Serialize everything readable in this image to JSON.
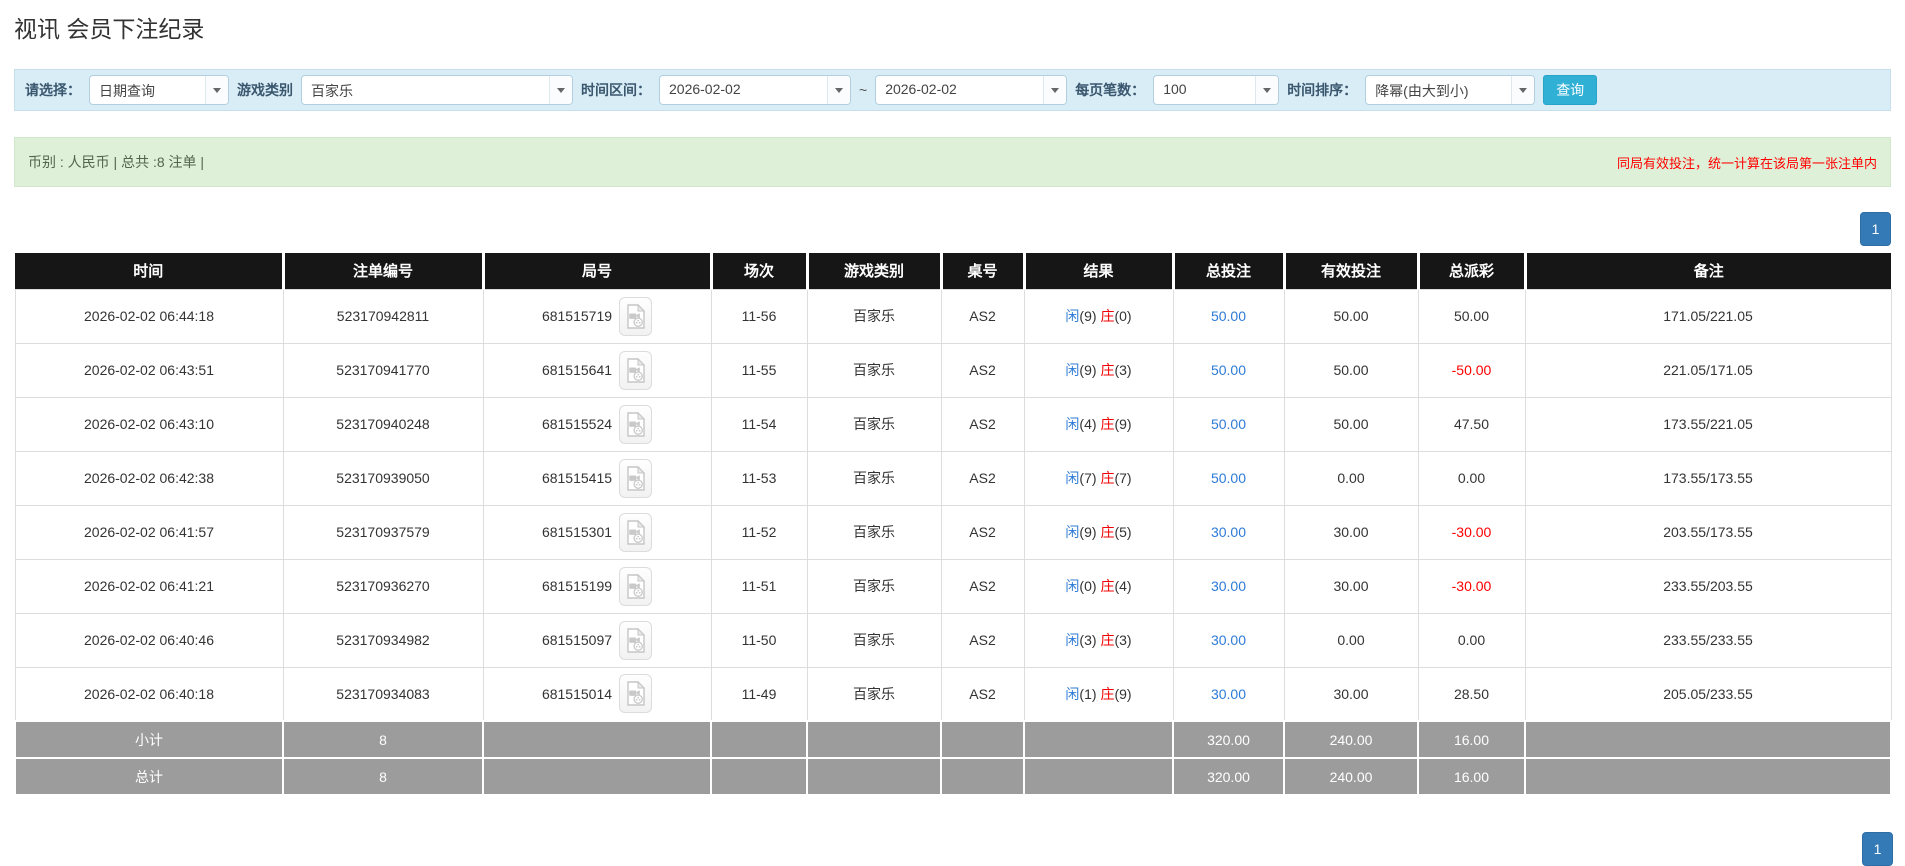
{
  "title": "视讯 会员下注纪录",
  "filters": {
    "select_label": "请选择：",
    "select_value": "日期查询",
    "game_type_label": "游戏类别",
    "game_type_value": "百家乐",
    "time_range_label": "时间区间：",
    "date_from": "2026-02-02",
    "range_separator": "~",
    "date_to": "2026-02-02",
    "page_size_label": "每页笔数：",
    "page_size_value": "100",
    "sort_label": "时间排序：",
    "sort_value": "降幂(由大到小)",
    "search_button": "查询"
  },
  "info_bar": {
    "left": "币别 : 人民币 | 总共 :8 注单 |",
    "right": "同局有效投注，统一计算在该局第一张注单内"
  },
  "pagination": {
    "page": "1"
  },
  "colors": {
    "accent_blue": "#31b0d5",
    "link_blue": "#2e7bd6",
    "negative_red": "#ff0000",
    "pagination_blue": "#337ab7",
    "header_black": "#161616",
    "footer_gray": "#9c9c9c",
    "filter_bg": "#d9edf7",
    "info_bg": "#dff0d8"
  },
  "table": {
    "columns": [
      {
        "key": "time",
        "label": "时间"
      },
      {
        "key": "bet_id",
        "label": "注单编号"
      },
      {
        "key": "round_id",
        "label": "局号"
      },
      {
        "key": "session",
        "label": "场次"
      },
      {
        "key": "game_type",
        "label": "游戏类别"
      },
      {
        "key": "table_no",
        "label": "桌号"
      },
      {
        "key": "result",
        "label": "结果"
      },
      {
        "key": "total_bet",
        "label": "总投注"
      },
      {
        "key": "valid_bet",
        "label": "有效投注"
      },
      {
        "key": "payout",
        "label": "总派彩"
      },
      {
        "key": "remark",
        "label": "备注"
      }
    ],
    "rows": [
      {
        "time": "2026-02-02 06:44:18",
        "bet_id": "523170942811",
        "round_id": "681515719",
        "session": "11-56",
        "game_type": "百家乐",
        "table_no": "AS2",
        "result": {
          "player": "闲",
          "player_score": "(9)",
          "banker": "庄",
          "banker_score": "(0)"
        },
        "total_bet": "50.00",
        "valid_bet": "50.00",
        "payout": "50.00",
        "remark": "171.05/221.05"
      },
      {
        "time": "2026-02-02 06:43:51",
        "bet_id": "523170941770",
        "round_id": "681515641",
        "session": "11-55",
        "game_type": "百家乐",
        "table_no": "AS2",
        "result": {
          "player": "闲",
          "player_score": "(9)",
          "banker": "庄",
          "banker_score": "(3)"
        },
        "total_bet": "50.00",
        "valid_bet": "50.00",
        "payout": "-50.00",
        "remark": "221.05/171.05"
      },
      {
        "time": "2026-02-02 06:43:10",
        "bet_id": "523170940248",
        "round_id": "681515524",
        "session": "11-54",
        "game_type": "百家乐",
        "table_no": "AS2",
        "result": {
          "player": "闲",
          "player_score": "(4)",
          "banker": "庄",
          "banker_score": "(9)"
        },
        "total_bet": "50.00",
        "valid_bet": "50.00",
        "payout": "47.50",
        "remark": "173.55/221.05"
      },
      {
        "time": "2026-02-02 06:42:38",
        "bet_id": "523170939050",
        "round_id": "681515415",
        "session": "11-53",
        "game_type": "百家乐",
        "table_no": "AS2",
        "result": {
          "player": "闲",
          "player_score": "(7)",
          "banker": "庄",
          "banker_score": "(7)"
        },
        "total_bet": "50.00",
        "valid_bet": "0.00",
        "payout": "0.00",
        "remark": "173.55/173.55"
      },
      {
        "time": "2026-02-02 06:41:57",
        "bet_id": "523170937579",
        "round_id": "681515301",
        "session": "11-52",
        "game_type": "百家乐",
        "table_no": "AS2",
        "result": {
          "player": "闲",
          "player_score": "(9)",
          "banker": "庄",
          "banker_score": "(5)"
        },
        "total_bet": "30.00",
        "valid_bet": "30.00",
        "payout": "-30.00",
        "remark": "203.55/173.55"
      },
      {
        "time": "2026-02-02 06:41:21",
        "bet_id": "523170936270",
        "round_id": "681515199",
        "session": "11-51",
        "game_type": "百家乐",
        "table_no": "AS2",
        "result": {
          "player": "闲",
          "player_score": "(0)",
          "banker": "庄",
          "banker_score": "(4)"
        },
        "total_bet": "30.00",
        "valid_bet": "30.00",
        "payout": "-30.00",
        "remark": "233.55/203.55"
      },
      {
        "time": "2026-02-02 06:40:46",
        "bet_id": "523170934982",
        "round_id": "681515097",
        "session": "11-50",
        "game_type": "百家乐",
        "table_no": "AS2",
        "result": {
          "player": "闲",
          "player_score": "(3)",
          "banker": "庄",
          "banker_score": "(3)"
        },
        "total_bet": "30.00",
        "valid_bet": "0.00",
        "payout": "0.00",
        "remark": "233.55/233.55"
      },
      {
        "time": "2026-02-02 06:40:18",
        "bet_id": "523170934083",
        "round_id": "681515014",
        "session": "11-49",
        "game_type": "百家乐",
        "table_no": "AS2",
        "result": {
          "player": "闲",
          "player_score": "(1)",
          "banker": "庄",
          "banker_score": "(9)"
        },
        "total_bet": "30.00",
        "valid_bet": "30.00",
        "payout": "28.50",
        "remark": "205.05/233.55"
      }
    ],
    "footer": [
      {
        "label": "小计",
        "count": "8",
        "total_bet": "320.00",
        "valid_bet": "240.00",
        "payout": "16.00"
      },
      {
        "label": "总计",
        "count": "8",
        "total_bet": "320.00",
        "valid_bet": "240.00",
        "payout": "16.00"
      }
    ]
  }
}
